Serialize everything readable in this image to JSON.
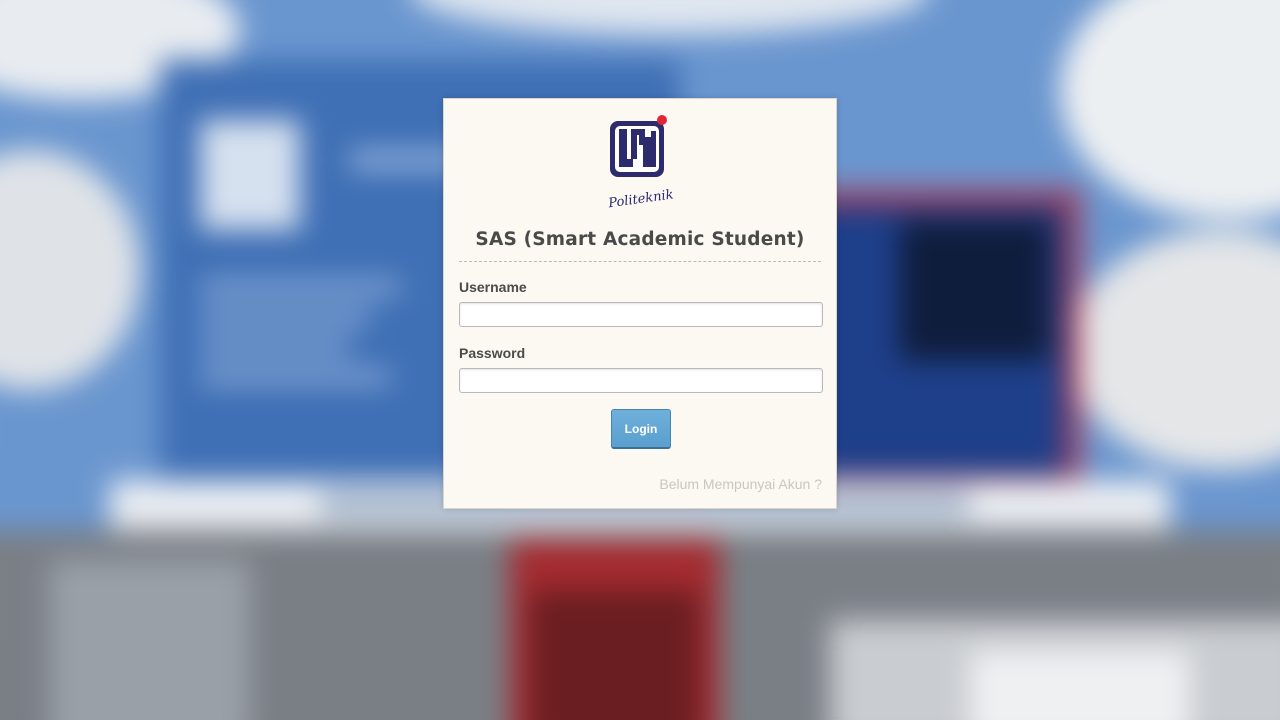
{
  "brand": {
    "logo_text": "LP3I",
    "logo_script": "Politeknik"
  },
  "login_form": {
    "title": "SAS (Smart Academic Student)",
    "username_label": "Username",
    "username_value": "",
    "password_label": "Password",
    "password_value": "",
    "login_button": "Login",
    "register_link": "Belum Mempunyai Akun ?"
  },
  "colors": {
    "card_background": "#fbf9f1",
    "button_blue": "#5a9fcf",
    "logo_navy": "#2e2a6e",
    "logo_red_dot": "#e32636"
  }
}
